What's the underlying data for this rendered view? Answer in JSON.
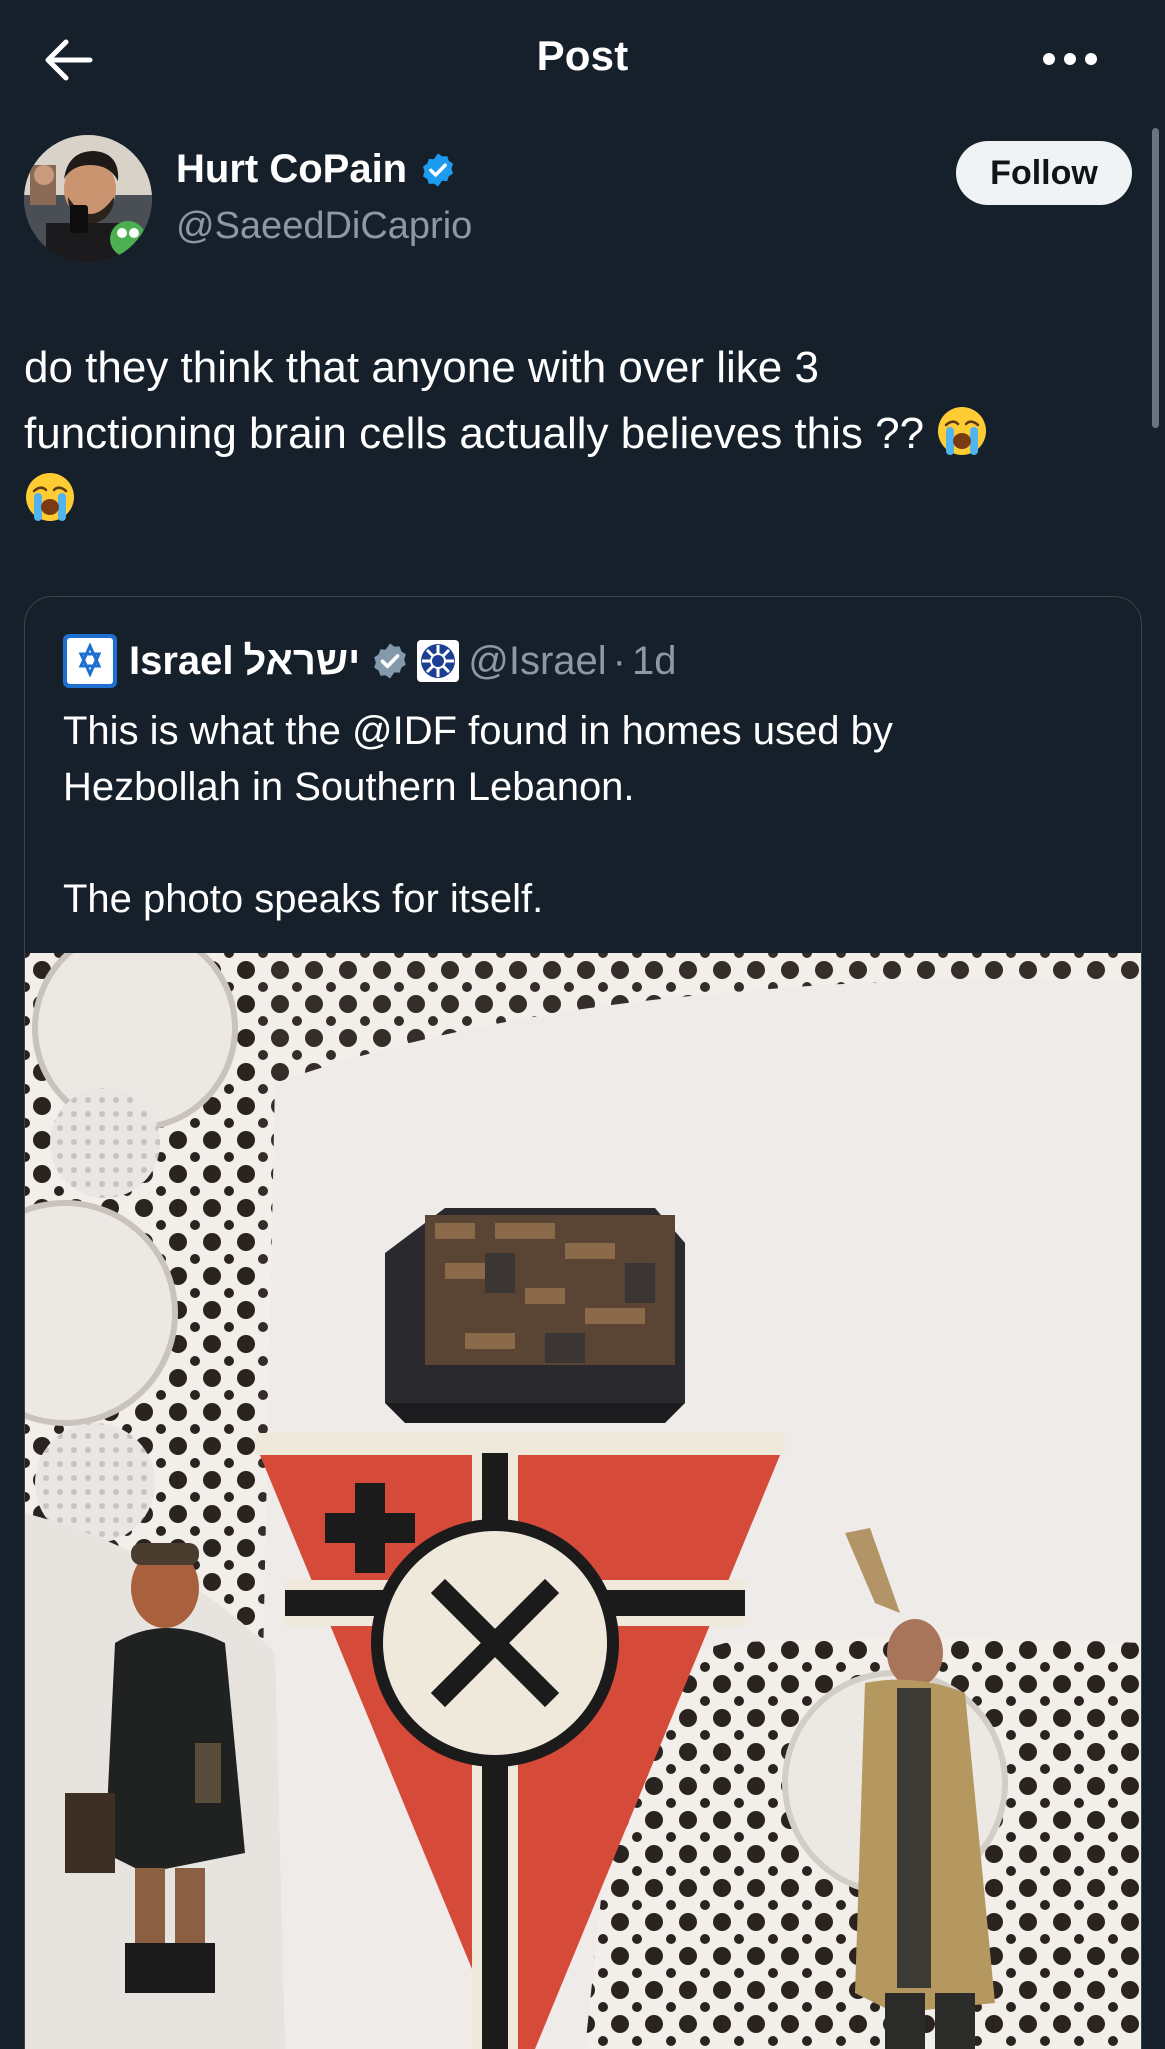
{
  "header": {
    "back_icon": "arrow-left-icon",
    "title": "Post",
    "more_icon": "more-horizontal-icon"
  },
  "author": {
    "name": "Hurt CoPain",
    "verified": true,
    "handle": "@SaeedDiCaprio",
    "follow_label": "Follow"
  },
  "tweet": {
    "line1": "do they think that anyone with over like 3",
    "line2": "functioning brain cells actually believes this ??",
    "emoji_1": "loudly-crying-face",
    "emoji_2": "loudly-crying-face"
  },
  "quote": {
    "name_en": "Israel",
    "name_he": "ישראל",
    "verified": true,
    "affiliation_badge": "gov-emblem-icon",
    "handle": "@Israel",
    "separator": "·",
    "time": "1d",
    "text_line1": "This is what the @IDF found in homes used by",
    "text_line2": "Hezbollah in Southern Lebanon.",
    "text_line3": "The photo speaks for itself.",
    "photo_description_icon": "attached-photo"
  },
  "colors": {
    "background": "#15202b",
    "text": "#ffffff",
    "secondary": "#8b98a5",
    "verified_blue": "#1d9bf0",
    "gov_gray": "#829aab",
    "follow_bg": "#eff3f4"
  }
}
